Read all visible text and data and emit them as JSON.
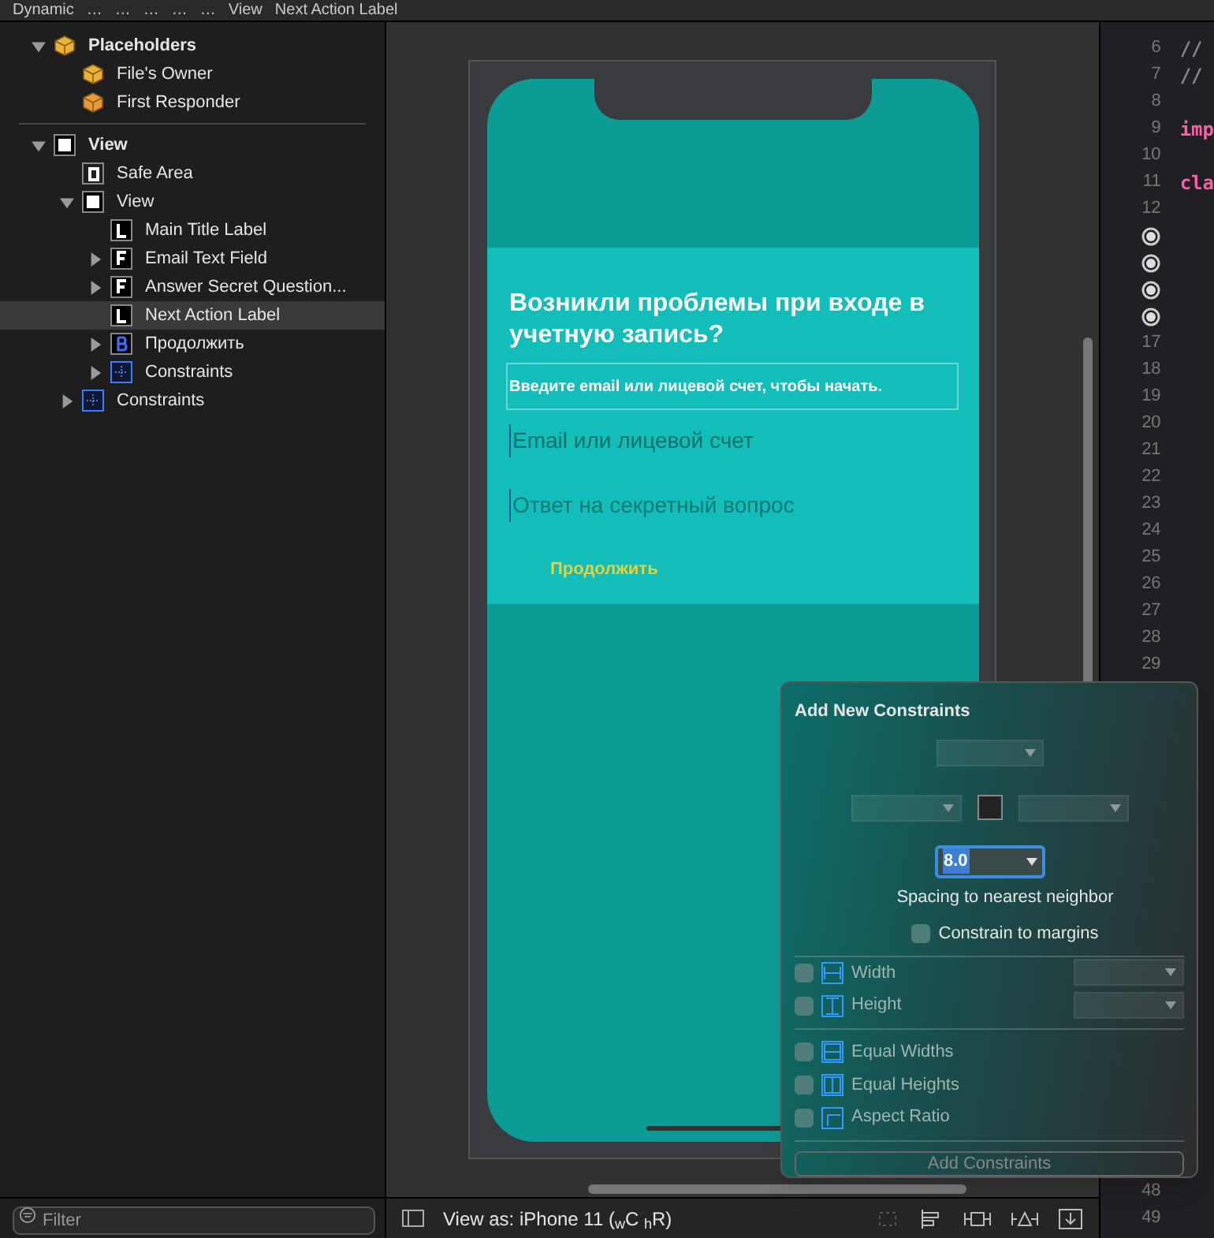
{
  "breadcrumb": [
    "Dynamic",
    "…",
    "…",
    "…",
    "…",
    "…",
    "View",
    "Next Action Label"
  ],
  "outline": [
    {
      "label": "Placeholders",
      "kind": "cube",
      "expanded": true,
      "selected": false,
      "children": [
        {
          "label": "File's Owner",
          "kind": "cube",
          "selected": false
        },
        {
          "label": "First Responder",
          "kind": "responder",
          "selected": false
        }
      ]
    },
    {
      "label": "View",
      "kind": "view",
      "expanded": true,
      "selected": false,
      "children": [
        {
          "label": "Safe Area",
          "kind": "safe",
          "selected": false
        },
        {
          "label": "View",
          "kind": "view",
          "expanded": true,
          "selected": false,
          "children": [
            {
              "label": "Main Title Label",
              "kind": "label",
              "selected": false
            },
            {
              "label": "Email Text Field",
              "kind": "field",
              "expanded": false,
              "selected": false
            },
            {
              "label": "Answer Secret Question...",
              "kind": "field",
              "expanded": false,
              "selected": false
            },
            {
              "label": "Next Action Label",
              "kind": "label",
              "selected": true
            },
            {
              "label": "Продолжить",
              "kind": "button",
              "expanded": false,
              "selected": false
            },
            {
              "label": "Constraints",
              "kind": "constraints",
              "expanded": false,
              "selected": false
            }
          ]
        },
        {
          "label": "Constraints",
          "kind": "constraints",
          "expanded": false,
          "selected": false
        }
      ]
    }
  ],
  "filter": {
    "placeholder": "Filter"
  },
  "phone": {
    "title": "Возникли проблемы при входе в учетную запись?",
    "subtitle": "Введите email или лицевой счет, чтобы начать.",
    "email_placeholder": "Email или лицевой счет",
    "answer_placeholder": "Ответ на секретный вопрос",
    "continue": "Продолжить"
  },
  "view_as": "View as: iPhone 11 ($_{w}$C $_{h}$R)",
  "popover": {
    "title": "Add New Constraints",
    "spacing": "8.0",
    "spacing_label": "Spacing to nearest neighbor",
    "margins": {
      "label": "Constrain to margins",
      "checked": false
    },
    "size": [
      {
        "label": "Width",
        "checked": false
      },
      {
        "label": "Height",
        "checked": false
      }
    ],
    "equal": [
      {
        "label": "Equal Widths",
        "checked": false
      },
      {
        "label": "Equal Heights",
        "checked": false
      },
      {
        "label": "Aspect Ratio",
        "checked": false
      }
    ],
    "button": "Add Constraints"
  },
  "code_lines": [
    {
      "n": "6",
      "code": "//"
    },
    {
      "n": "7",
      "code": "//"
    },
    {
      "n": "8"
    },
    {
      "n": "9",
      "code": "imp"
    },
    {
      "n": "10"
    },
    {
      "n": "11",
      "code": "cla"
    },
    {
      "n": "12"
    },
    {
      "kind": "breakpoint"
    },
    {
      "kind": "breakpoint"
    },
    {
      "kind": "breakpoint"
    },
    {
      "kind": "breakpoint"
    },
    {
      "n": "17"
    },
    {
      "n": "18"
    },
    {
      "n": "19"
    },
    {
      "n": "20"
    },
    {
      "n": "21"
    },
    {
      "n": "22"
    },
    {
      "n": "23"
    },
    {
      "n": "24"
    },
    {
      "n": "25"
    },
    {
      "n": "26"
    },
    {
      "n": "27"
    },
    {
      "n": "28"
    },
    {
      "n": "29"
    }
  ],
  "code_lines_bottom": [
    {
      "n": "48"
    },
    {
      "n": "49"
    }
  ]
}
